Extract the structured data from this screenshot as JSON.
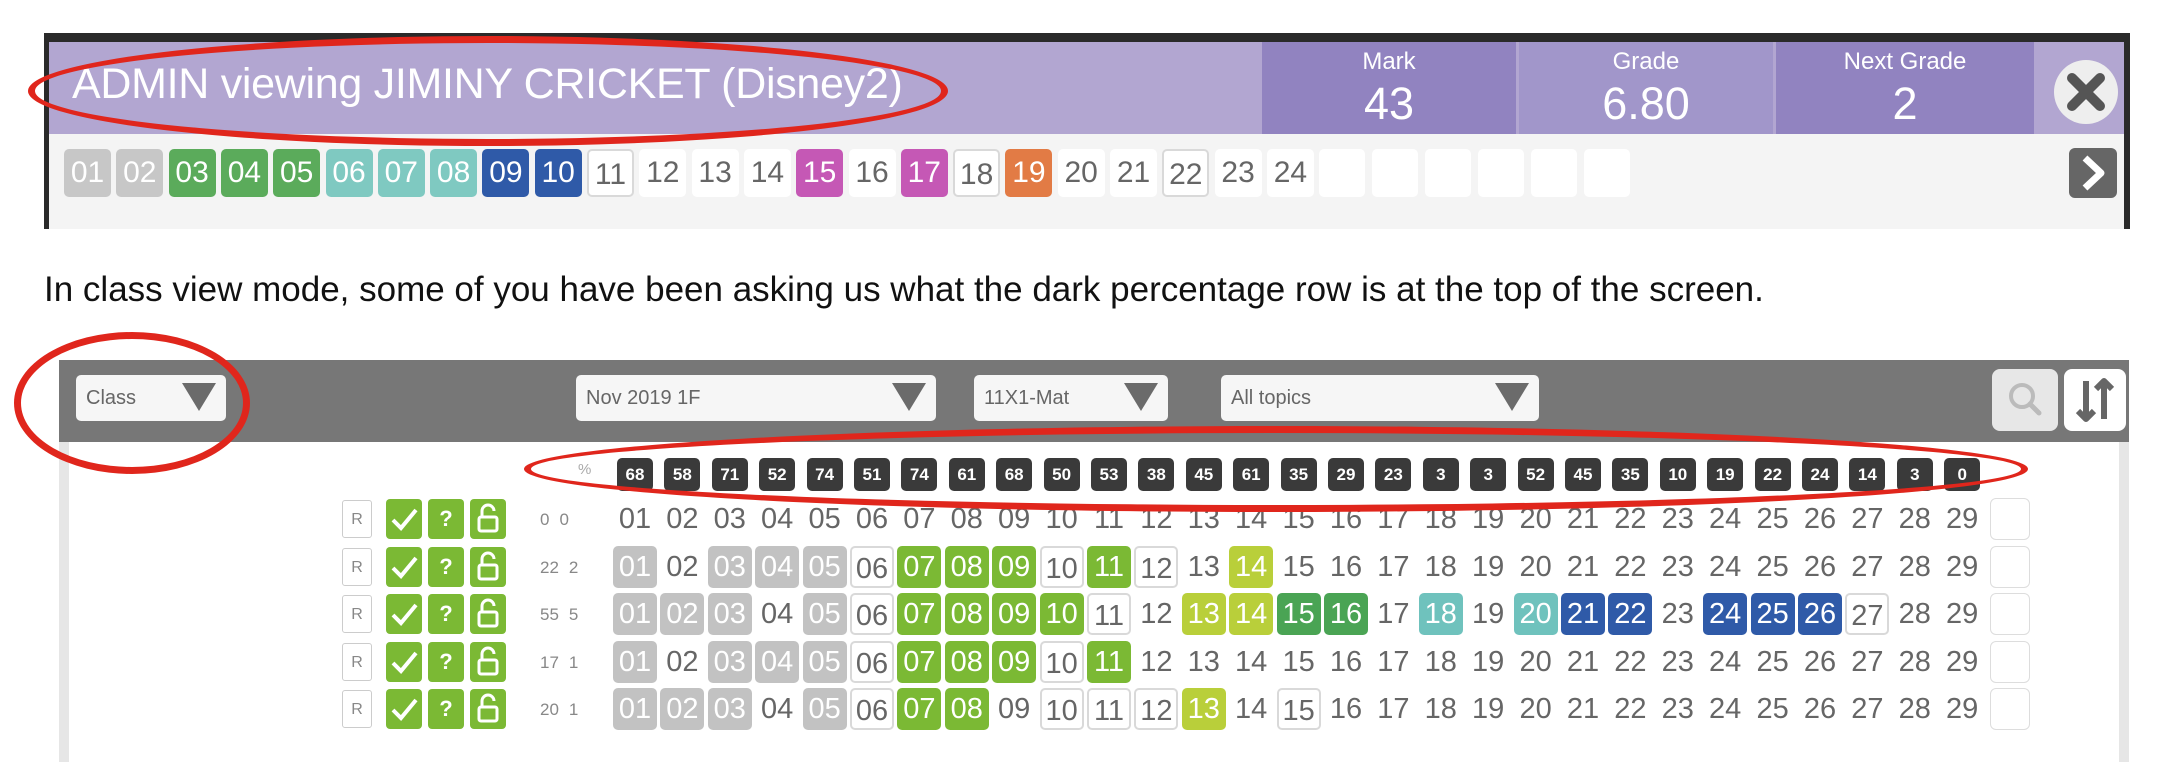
{
  "top_panel": {
    "title": "ADMIN viewing JIMINY CRICKET (Disney2)",
    "stats": [
      {
        "label": "Mark",
        "value": "43"
      },
      {
        "label": "Grade",
        "value": "6.80"
      },
      {
        "label": "Next Grade",
        "value": "2"
      }
    ],
    "close_icon": "close-x-icon",
    "next_icon": "chevron-right-icon",
    "topic_tiles": [
      {
        "label": "01",
        "status": "grey"
      },
      {
        "label": "02",
        "status": "grey"
      },
      {
        "label": "03",
        "status": "green"
      },
      {
        "label": "04",
        "status": "green"
      },
      {
        "label": "05",
        "status": "green"
      },
      {
        "label": "06",
        "status": "teal"
      },
      {
        "label": "07",
        "status": "teal"
      },
      {
        "label": "08",
        "status": "teal"
      },
      {
        "label": "09",
        "status": "blue"
      },
      {
        "label": "10",
        "status": "blue"
      },
      {
        "label": "11",
        "status": "white"
      },
      {
        "label": "12",
        "status": "plain"
      },
      {
        "label": "13",
        "status": "plain"
      },
      {
        "label": "14",
        "status": "plain"
      },
      {
        "label": "15",
        "status": "magenta"
      },
      {
        "label": "16",
        "status": "plain"
      },
      {
        "label": "17",
        "status": "magenta"
      },
      {
        "label": "18",
        "status": "white"
      },
      {
        "label": "19",
        "status": "orange"
      },
      {
        "label": "20",
        "status": "plain"
      },
      {
        "label": "21",
        "status": "plain"
      },
      {
        "label": "22",
        "status": "white"
      },
      {
        "label": "23",
        "status": "plain"
      },
      {
        "label": "24",
        "status": "plain"
      },
      {
        "label": "",
        "status": "empty"
      },
      {
        "label": "",
        "status": "empty"
      },
      {
        "label": "",
        "status": "empty"
      },
      {
        "label": "",
        "status": "empty"
      },
      {
        "label": "",
        "status": "empty"
      },
      {
        "label": "",
        "status": "empty"
      }
    ]
  },
  "caption": "In class view mode, some of you have been asking us what the dark percentage row is at the top of the screen.",
  "class_panel": {
    "view_select": "Class",
    "exam_select": "Nov 2019 1F",
    "class_select": "11X1-Mat",
    "topic_select": "All topics",
    "search_icon": "search-icon",
    "sort_icon": "sort-arrows-icon",
    "percent_label": "%",
    "percentages": [
      "68",
      "58",
      "71",
      "52",
      "74",
      "51",
      "74",
      "61",
      "68",
      "50",
      "53",
      "38",
      "45",
      "61",
      "35",
      "29",
      "23",
      "3",
      "3",
      "52",
      "45",
      "35",
      "10",
      "19",
      "22",
      "24",
      "14",
      "3",
      "0"
    ],
    "row_button_label": "R",
    "grade_icons": [
      "check-icon",
      "question-icon",
      "unlock-icon"
    ],
    "question_numbers": [
      "01",
      "02",
      "03",
      "04",
      "05",
      "06",
      "07",
      "08",
      "09",
      "10",
      "11",
      "12",
      "13",
      "14",
      "15",
      "16",
      "17",
      "18",
      "19",
      "20",
      "21",
      "22",
      "23",
      "24",
      "25",
      "26",
      "27",
      "28",
      "29"
    ],
    "students": [
      {
        "score": "0",
        "grade": "0",
        "cells": [
          "p",
          "p",
          "p",
          "p",
          "p",
          "p",
          "p",
          "p",
          "p",
          "p",
          "p",
          "p",
          "p",
          "p",
          "p",
          "p",
          "p",
          "p",
          "p",
          "p",
          "p",
          "p",
          "p",
          "p",
          "p",
          "p",
          "p",
          "p",
          "p"
        ]
      },
      {
        "score": "22",
        "grade": "2",
        "cells": [
          "grey",
          "p",
          "grey",
          "grey",
          "grey",
          "w",
          "g",
          "g",
          "g",
          "w",
          "g",
          "w",
          "p",
          "lime",
          "p",
          "p",
          "p",
          "p",
          "p",
          "p",
          "p",
          "p",
          "p",
          "p",
          "p",
          "p",
          "p",
          "p",
          "p"
        ]
      },
      {
        "score": "55",
        "grade": "5",
        "cells": [
          "grey",
          "grey",
          "grey",
          "p",
          "grey",
          "w",
          "g",
          "g",
          "g",
          "g",
          "w",
          "p",
          "lime",
          "lime",
          "dg",
          "dg",
          "p",
          "teal",
          "p",
          "teal",
          "blue",
          "blue",
          "p",
          "blue",
          "blue",
          "blue",
          "w",
          "p",
          "p"
        ]
      },
      {
        "score": "17",
        "grade": "1",
        "cells": [
          "grey",
          "p",
          "grey",
          "grey",
          "grey",
          "w",
          "g",
          "g",
          "g",
          "w",
          "g",
          "p",
          "p",
          "p",
          "p",
          "p",
          "p",
          "p",
          "p",
          "p",
          "p",
          "p",
          "p",
          "p",
          "p",
          "p",
          "p",
          "p",
          "p"
        ]
      },
      {
        "score": "20",
        "grade": "1",
        "cells": [
          "grey",
          "grey",
          "grey",
          "p",
          "grey",
          "w",
          "g",
          "g",
          "p",
          "w",
          "w",
          "w",
          "lime",
          "p",
          "w",
          "p",
          "p",
          "p",
          "p",
          "p",
          "p",
          "p",
          "p",
          "p",
          "p",
          "p",
          "p",
          "p",
          "p"
        ]
      }
    ]
  },
  "colors": {
    "panel_purple": "#b2a6d1",
    "stat_purple": "#9183c0",
    "annotation_red": "#e0261c",
    "dark_bar": "#777777"
  }
}
